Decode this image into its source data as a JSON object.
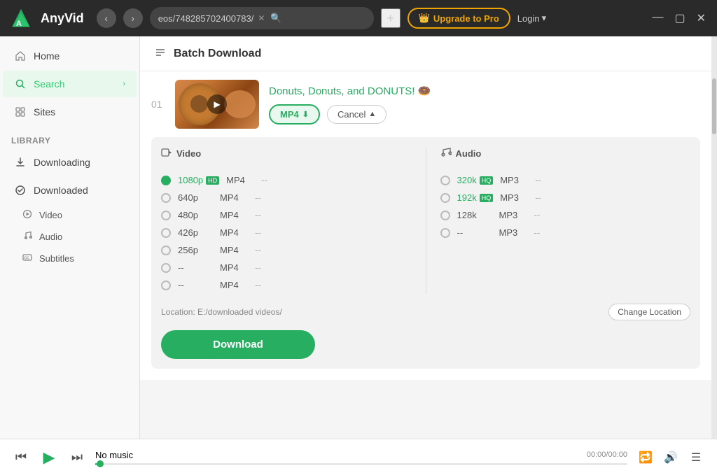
{
  "app": {
    "name": "AnyVid",
    "url": "eos/748285702400783/",
    "upgrade_label": "Upgrade to Pro",
    "login_label": "Login"
  },
  "sidebar": {
    "section_label": "Library",
    "items": [
      {
        "id": "home",
        "label": "Home",
        "icon": "home"
      },
      {
        "id": "search",
        "label": "Search",
        "icon": "search",
        "active": true,
        "has_arrow": true
      },
      {
        "id": "sites",
        "label": "Sites",
        "icon": "grid"
      }
    ],
    "library_items": [
      {
        "id": "downloading",
        "label": "Downloading",
        "icon": "download-arrow"
      },
      {
        "id": "downloaded",
        "label": "Downloaded",
        "icon": "check-circle"
      }
    ],
    "sub_items": [
      {
        "id": "video",
        "label": "Video",
        "icon": "play-circle"
      },
      {
        "id": "audio",
        "label": "Audio",
        "icon": "music-note"
      },
      {
        "id": "subtitles",
        "label": "Subtitles",
        "icon": "cc"
      }
    ]
  },
  "batch": {
    "title": "Batch Download",
    "item_num": "01",
    "video_title": "Donuts, Donuts, and DONUTS! 🍩",
    "format_btn": "MP4",
    "cancel_btn": "Cancel"
  },
  "video_section": {
    "header": "Video",
    "rows": [
      {
        "res": "1080p",
        "badge": "HD",
        "format": "MP4",
        "size": "--",
        "is_green": true
      },
      {
        "res": "640p",
        "badge": "",
        "format": "MP4",
        "size": "--",
        "is_green": false
      },
      {
        "res": "480p",
        "badge": "",
        "format": "MP4",
        "size": "--",
        "is_green": false
      },
      {
        "res": "426p",
        "badge": "",
        "format": "MP4",
        "size": "--",
        "is_green": false
      },
      {
        "res": "256p",
        "badge": "",
        "format": "MP4",
        "size": "--",
        "is_green": false
      },
      {
        "res": "--",
        "badge": "",
        "format": "MP4",
        "size": "--",
        "is_green": false
      },
      {
        "res": "--",
        "badge": "",
        "format": "MP4",
        "size": "--",
        "is_green": false
      }
    ]
  },
  "audio_section": {
    "header": "Audio",
    "rows": [
      {
        "res": "320k",
        "badge": "HQ",
        "format": "MP3",
        "size": "--",
        "is_green": true
      },
      {
        "res": "192k",
        "badge": "HQ",
        "format": "MP3",
        "size": "--",
        "is_green": true
      },
      {
        "res": "128k",
        "badge": "",
        "format": "MP3",
        "size": "--",
        "is_green": false
      },
      {
        "res": "--",
        "badge": "",
        "format": "MP3",
        "size": "--",
        "is_green": false
      }
    ]
  },
  "location": {
    "label": "Location: E:/downloaded videos/",
    "change_btn": "Change Location"
  },
  "download_btn": "Download",
  "player": {
    "title": "No music",
    "time": "00:00/00:00"
  }
}
